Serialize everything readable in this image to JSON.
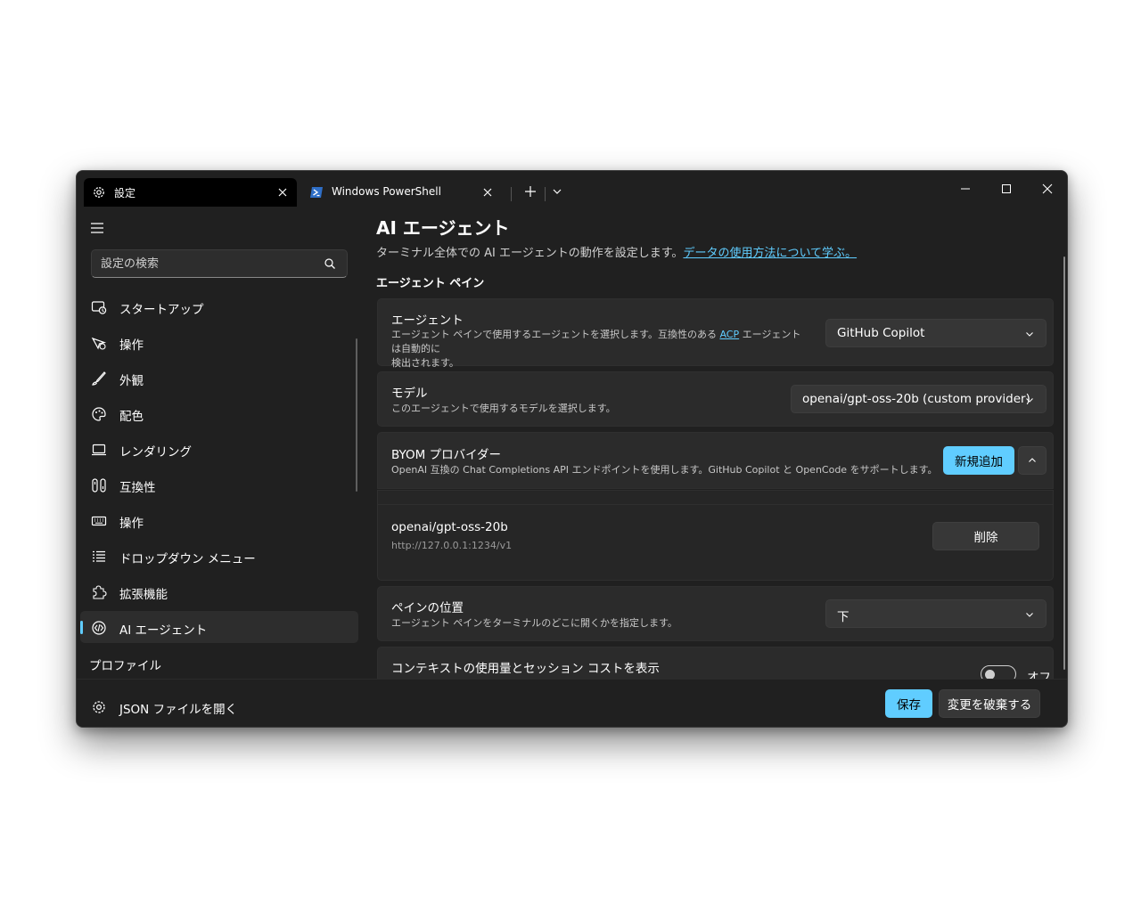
{
  "colors": {
    "accent": "#60cdff",
    "background": "#202020",
    "card": "#2b2b2b"
  },
  "tabs": [
    {
      "label": "設定",
      "icon": "gear-icon"
    },
    {
      "label": "Windows PowerShell",
      "icon": "powershell-icon"
    }
  ],
  "sidebar": {
    "search_placeholder": "設定の検索",
    "items": [
      {
        "label": "スタートアップ",
        "icon": "startup-icon"
      },
      {
        "label": "操作",
        "icon": "interaction-icon"
      },
      {
        "label": "外観",
        "icon": "brush-icon"
      },
      {
        "label": "配色",
        "icon": "palette-icon"
      },
      {
        "label": "レンダリング",
        "icon": "monitor-icon"
      },
      {
        "label": "互換性",
        "icon": "compatibility-icon"
      },
      {
        "label": "操作",
        "icon": "keyboard-icon"
      },
      {
        "label": "ドロップダウン メニュー",
        "icon": "list-icon"
      },
      {
        "label": "拡張機能",
        "icon": "puzzle-icon"
      },
      {
        "label": "AI エージェント",
        "icon": "ai-agent-icon",
        "selected": true
      }
    ],
    "profiles_heading": "プロファイル"
  },
  "main": {
    "title": "AI エージェント",
    "description": "ターミナル全体での AI エージェントの動作を設定します。",
    "description_link": "データの使用方法について学ぶ。",
    "section_title": "エージェント ペイン",
    "agent": {
      "title": "エージェント",
      "desc_part1": "エージェント ペインで使用するエージェントを選択します。互換性のある ",
      "desc_link": "ACP",
      "desc_part2": " エージェントは自動的に",
      "desc_line2": "検出されます。",
      "value": "GitHub Copilot"
    },
    "model": {
      "title": "モデル",
      "desc": "このエージェントで使用するモデルを選択します。",
      "value": "openai/gpt-oss-20b (custom provider)"
    },
    "byom": {
      "title": "BYOM プロバイダー",
      "desc": "OpenAI 互換の Chat Completions API エンドポイントを使用します。GitHub Copilot と OpenCode をサポートします。",
      "add_label": "新規追加",
      "provider_name": "openai/gpt-oss-20b",
      "provider_url": "http://127.0.0.1:1234/v1",
      "delete_label": "削除"
    },
    "pane_position": {
      "title": "ペインの位置",
      "desc": "エージェント ペインをターミナルのどこに開くかを指定します。",
      "value": "下"
    },
    "context_usage": {
      "title": "コンテキストの使用量とセッション コストを表示",
      "toggle_label": "オフ",
      "toggle_on": false
    }
  },
  "footer": {
    "json_label": "JSON ファイルを開く",
    "save_label": "保存",
    "discard_label": "変更を破棄する"
  }
}
